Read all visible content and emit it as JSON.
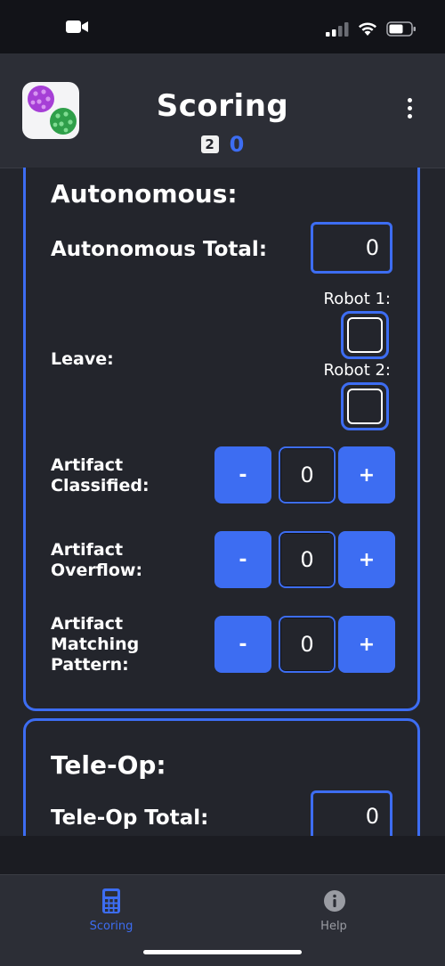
{
  "header": {
    "title": "Scoring",
    "season_badge": "2",
    "season_score": "0"
  },
  "autonomous": {
    "title": "Autonomous:",
    "total_label": "Autonomous Total:",
    "total_value": "0",
    "leave_label": "Leave:",
    "robot1_label": "Robot 1:",
    "robot2_label": "Robot 2:",
    "robot1_checked": false,
    "robot2_checked": false,
    "rows": [
      {
        "label_line1": "Artifact",
        "label_line2": "Classified:",
        "label_line3": "",
        "value": "0"
      },
      {
        "label_line1": "Artifact",
        "label_line2": "Overflow:",
        "label_line3": "",
        "value": "0"
      },
      {
        "label_line1": "Artifact",
        "label_line2": "Matching",
        "label_line3": "Pattern:",
        "value": "0"
      }
    ],
    "minus_label": "-",
    "plus_label": "+"
  },
  "teleop": {
    "title": "Tele-Op:",
    "total_label": "Tele-Op Total:",
    "total_value": "0"
  },
  "tabs": [
    {
      "label": "Scoring",
      "icon": "calculator-icon",
      "active": true
    },
    {
      "label": "Help",
      "icon": "info-icon",
      "active": false
    }
  ],
  "colors": {
    "accent": "#3d6df2",
    "background": "#23252c",
    "header": "#2c2e36",
    "inactive_tab": "#9a9ca3"
  }
}
